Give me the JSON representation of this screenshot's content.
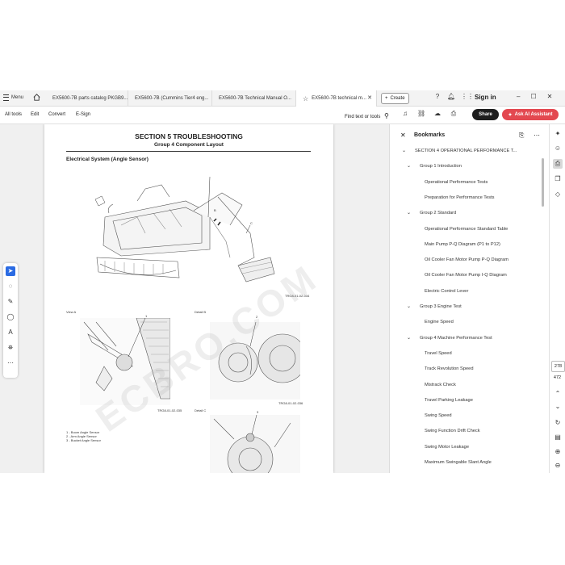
{
  "tabs": {
    "menu_label": "Menu",
    "items": [
      {
        "label": "EX5600-7B parts catalog PKGB9..."
      },
      {
        "label": "EX5600-7B (Cummins Tier4 eng..."
      },
      {
        "label": "EX5600-7B Technical Manual O..."
      },
      {
        "label": "EX5600-7B technical m..."
      }
    ],
    "create_label": "Create",
    "signin_label": "Sign in"
  },
  "toolbar": {
    "all_tools": "All tools",
    "edit": "Edit",
    "convert": "Convert",
    "esign": "E-Sign",
    "find": "Find text or tools",
    "share": "Share",
    "ai": "Ask AI Assistant"
  },
  "document": {
    "title": "SECTION 5 TROUBLESHOOTING",
    "subtitle": "Group 4 Component Layout",
    "section": "Electrical System (Angle Sensor)",
    "labels": {
      "b": "B",
      "c": "C",
      "fig1": "TRG8-01-02-034",
      "view_a": "View A",
      "detail_b": "Detail B",
      "detail_c": "Detail C",
      "fig2": "TRG8-01-02-035",
      "fig3": "TRG8-01-02-036",
      "n1": "1",
      "n2": "2",
      "n3": "3"
    },
    "legend": [
      "1 -   Boom Angle Sensor",
      "2 -   Arm Angle Sensor",
      "3 -   Bucket Angle Sensor"
    ],
    "watermark": "ECBRO.COM"
  },
  "bookmarks": {
    "title": "Bookmarks",
    "items": [
      {
        "label": "SECTION 4 OPERATIONAL PERFORMANCE T...",
        "level": 0,
        "chev": "down"
      },
      {
        "label": "Group 1 Introduction",
        "level": 1,
        "chev": "down"
      },
      {
        "label": "Operational Performance Tests",
        "level": 2,
        "chev": ""
      },
      {
        "label": "Preparation for Performance Tests",
        "level": 2,
        "chev": ""
      },
      {
        "label": "Group 2 Standard",
        "level": 1,
        "chev": "down"
      },
      {
        "label": "Operational Performance Standard Table",
        "level": 2,
        "chev": ""
      },
      {
        "label": "Main Pump P-Q Diagram (P1 to P12)",
        "level": 2,
        "chev": ""
      },
      {
        "label": "Oil Cooler Fan Motor Pump P-Q Diagram",
        "level": 2,
        "chev": ""
      },
      {
        "label": "Oil Cooler Fan Motor Pump I-Q Diagram",
        "level": 2,
        "chev": ""
      },
      {
        "label": "Electric Control Lever",
        "level": 2,
        "chev": ""
      },
      {
        "label": "Group 3 Engine Test",
        "level": 1,
        "chev": "down"
      },
      {
        "label": "Engine Speed",
        "level": 2,
        "chev": ""
      },
      {
        "label": "Group 4 Machine Performance Test",
        "level": 1,
        "chev": "down"
      },
      {
        "label": "Travel Speed",
        "level": 2,
        "chev": ""
      },
      {
        "label": "Track Revolution Speed",
        "level": 2,
        "chev": ""
      },
      {
        "label": "Mistrack Check",
        "level": 2,
        "chev": ""
      },
      {
        "label": "Travel Parking Leakage",
        "level": 2,
        "chev": ""
      },
      {
        "label": "Swing Speed",
        "level": 2,
        "chev": ""
      },
      {
        "label": "Swing Function Drift Check",
        "level": 2,
        "chev": ""
      },
      {
        "label": "Swing Motor Leakage",
        "level": 2,
        "chev": ""
      },
      {
        "label": "Maximum Swingable Slant Angle",
        "level": 2,
        "chev": ""
      }
    ]
  },
  "pagination": {
    "current": "278",
    "total": "472"
  },
  "colors": {
    "accent": "#2b6be3",
    "ai": "#e34850",
    "share": "#1e1e1e"
  }
}
